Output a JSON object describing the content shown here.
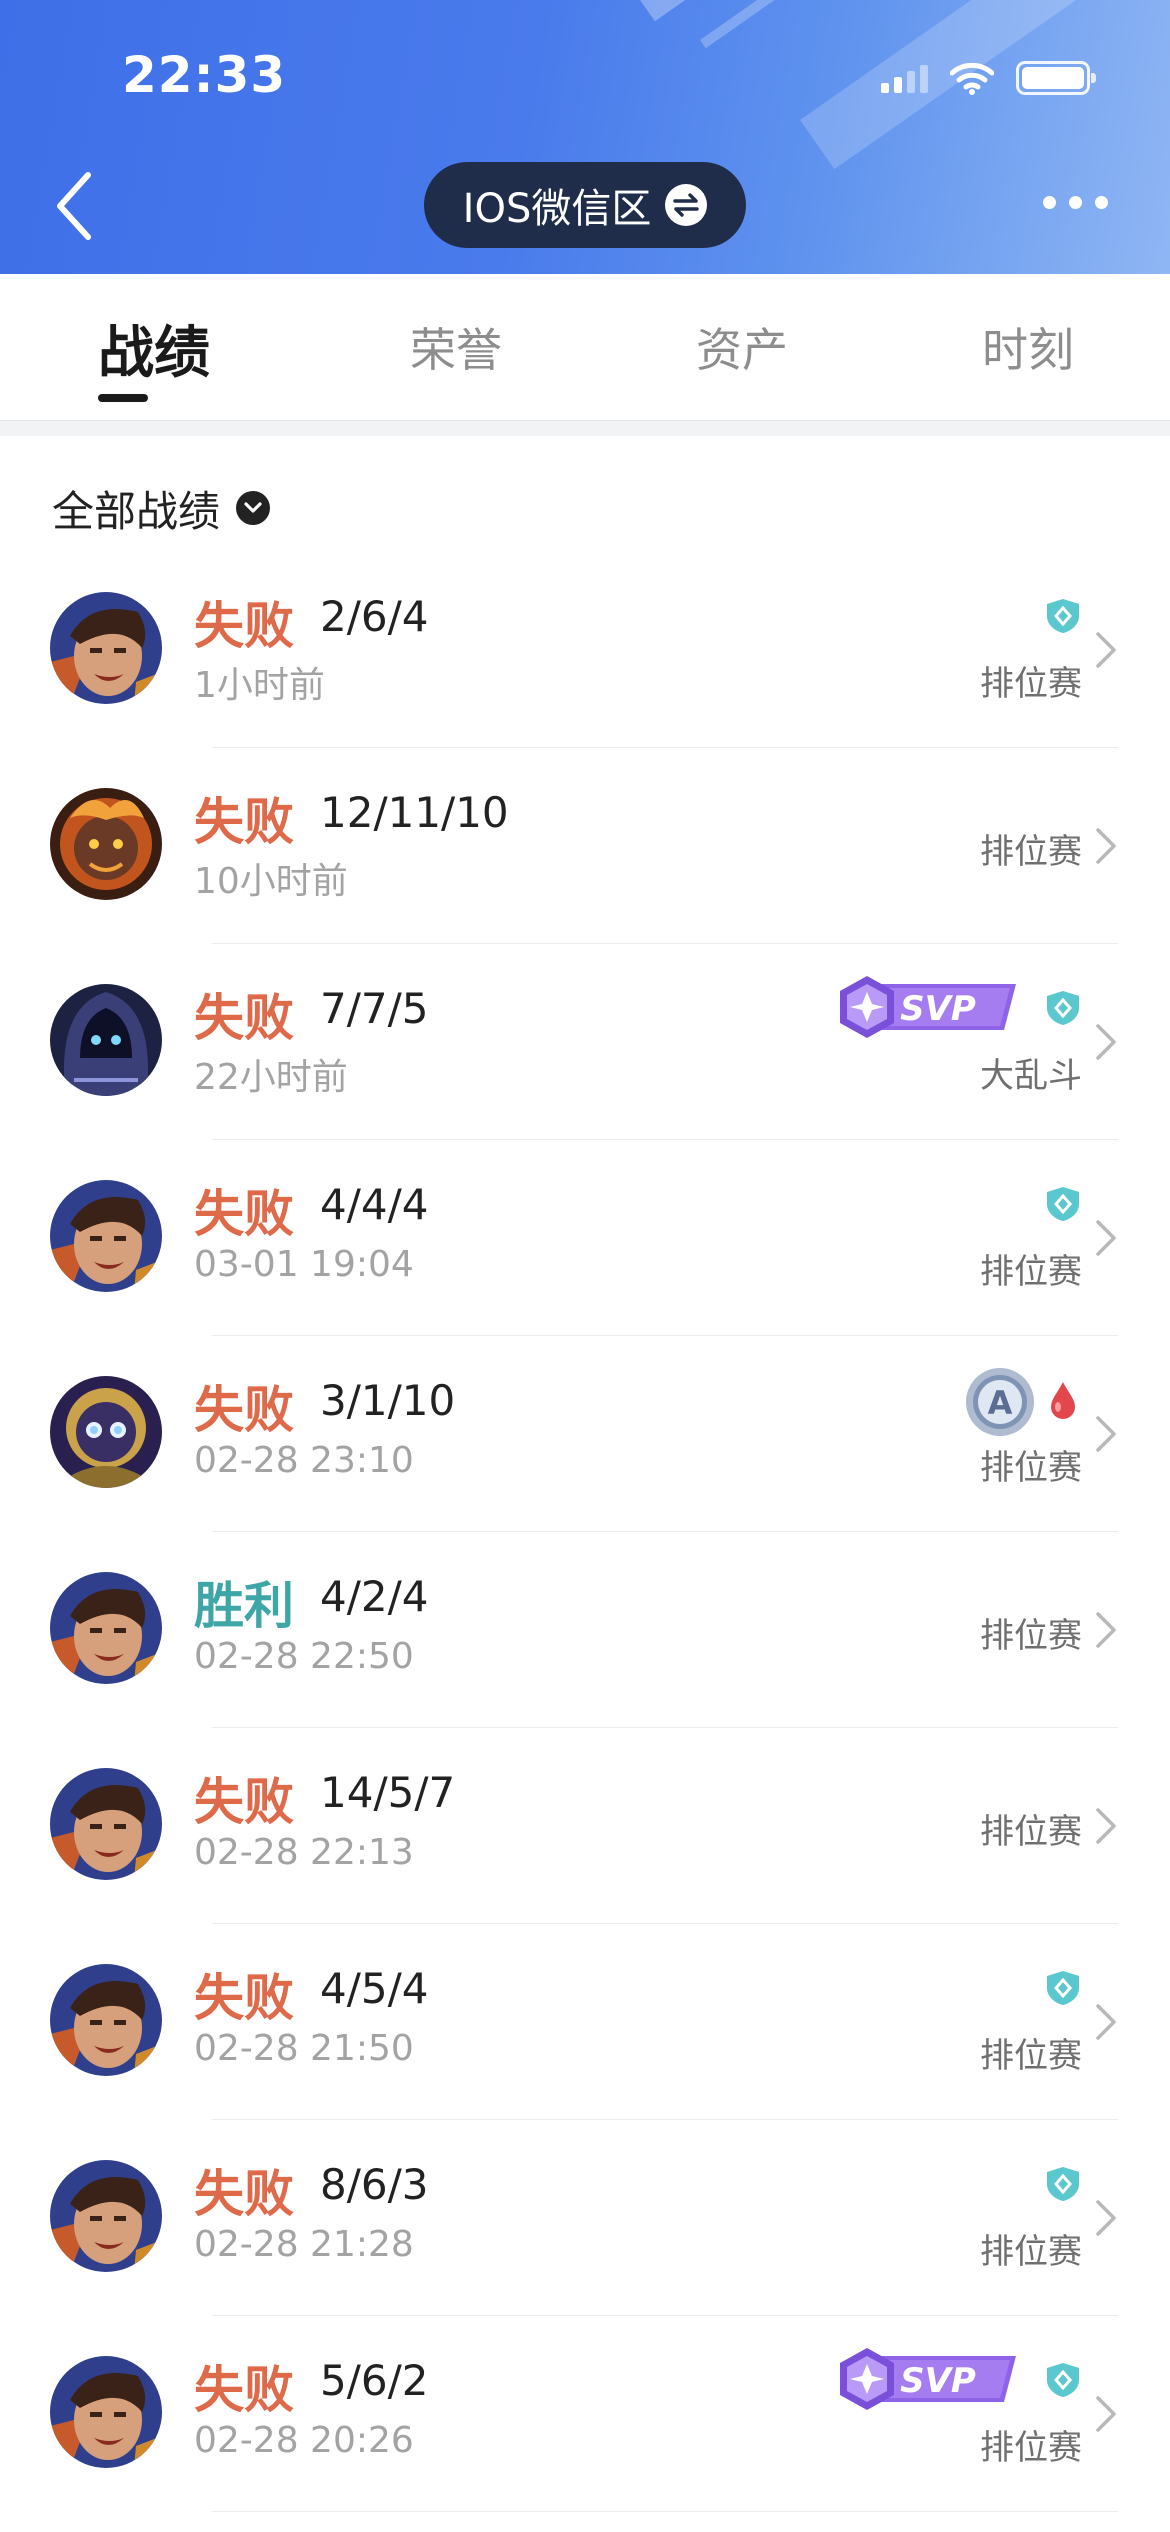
{
  "status_bar": {
    "time": "22:33"
  },
  "nav": {
    "server_label": "IOS微信区"
  },
  "tabs": [
    {
      "label": "战绩",
      "active": true
    },
    {
      "label": "荣誉",
      "active": false
    },
    {
      "label": "资产",
      "active": false
    },
    {
      "label": "时刻",
      "active": false
    }
  ],
  "filter": {
    "label": "全部战绩"
  },
  "colors": {
    "lose": "#de6a4a",
    "win": "#3ea6a6",
    "header": "#3f6fe8",
    "pill": "#1f2d4a"
  },
  "matches": [
    {
      "result": "失败",
      "kda": "2/6/4",
      "time": "1小时前",
      "mode": "排位赛",
      "hero_icon": "hero-warrior-icon",
      "badges": [
        "shield-badge"
      ]
    },
    {
      "result": "失败",
      "kda": "12/11/10",
      "time": "10小时前",
      "mode": "排位赛",
      "hero_icon": "hero-flame-beast-icon",
      "badges": []
    },
    {
      "result": "失败",
      "kda": "7/7/5",
      "time": "22小时前",
      "mode": "大乱斗",
      "hero_icon": "hero-hooded-icon",
      "badges": [
        "svp-badge",
        "shield-badge"
      ]
    },
    {
      "result": "失败",
      "kda": "4/4/4",
      "time": "03-01 19:04",
      "mode": "排位赛",
      "hero_icon": "hero-warrior-icon",
      "badges": [
        "shield-badge"
      ]
    },
    {
      "result": "失败",
      "kda": "3/1/10",
      "time": "02-28 23:10",
      "mode": "排位赛",
      "hero_icon": "hero-golden-mask-icon",
      "badges": [
        "a-rank-badge",
        "blood-drop-badge"
      ]
    },
    {
      "result": "胜利",
      "kda": "4/2/4",
      "time": "02-28 22:50",
      "mode": "排位赛",
      "hero_icon": "hero-warrior-icon",
      "badges": []
    },
    {
      "result": "失败",
      "kda": "14/5/7",
      "time": "02-28 22:13",
      "mode": "排位赛",
      "hero_icon": "hero-warrior-icon",
      "badges": []
    },
    {
      "result": "失败",
      "kda": "4/5/4",
      "time": "02-28 21:50",
      "mode": "排位赛",
      "hero_icon": "hero-warrior-icon",
      "badges": [
        "shield-badge"
      ]
    },
    {
      "result": "失败",
      "kda": "8/6/3",
      "time": "02-28 21:28",
      "mode": "排位赛",
      "hero_icon": "hero-warrior-icon",
      "badges": [
        "shield-badge"
      ]
    },
    {
      "result": "失败",
      "kda": "5/6/2",
      "time": "02-28 20:26",
      "mode": "排位赛",
      "hero_icon": "hero-warrior-icon",
      "badges": [
        "svp-badge",
        "shield-badge"
      ]
    }
  ]
}
